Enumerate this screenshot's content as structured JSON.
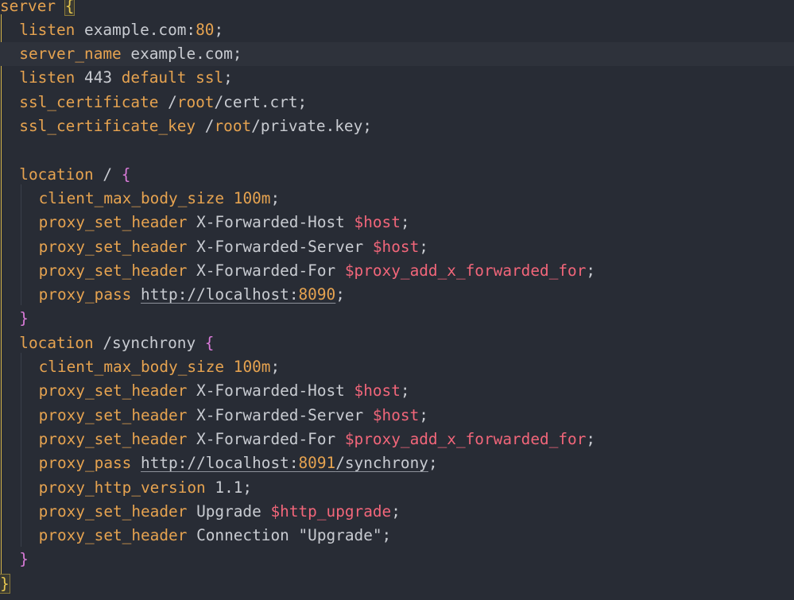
{
  "colors": {
    "background": "#282c35",
    "keyword": "#e6a350",
    "text": "#c9ccd2",
    "variable": "#f2667a",
    "brace": "#d97ad8",
    "bracket_match": "#e6c74f",
    "current_line": "#2e323b"
  },
  "lines": [
    {
      "indent": 0,
      "tokens": [
        {
          "t": "kw",
          "v": "server"
        },
        {
          "t": "txt",
          "v": " "
        },
        {
          "t": "match",
          "v": "{"
        }
      ]
    },
    {
      "indent": 1,
      "tokens": [
        {
          "t": "kw",
          "v": "listen"
        },
        {
          "t": "txt",
          "v": " example.com:"
        },
        {
          "t": "num",
          "v": "80"
        },
        {
          "t": "txt",
          "v": ";"
        }
      ]
    },
    {
      "indent": 1,
      "current": true,
      "tokens": [
        {
          "t": "kw",
          "v": "server_name"
        },
        {
          "t": "txt",
          "v": " example.com;"
        }
      ]
    },
    {
      "indent": 1,
      "tokens": [
        {
          "t": "kw",
          "v": "listen"
        },
        {
          "t": "txt",
          "v": " 443 "
        },
        {
          "t": "kw",
          "v": "default"
        },
        {
          "t": "txt",
          "v": " "
        },
        {
          "t": "kw",
          "v": "ssl"
        },
        {
          "t": "txt",
          "v": ";"
        }
      ]
    },
    {
      "indent": 1,
      "tokens": [
        {
          "t": "kw",
          "v": "ssl_certificate"
        },
        {
          "t": "txt",
          "v": " /"
        },
        {
          "t": "kw",
          "v": "root"
        },
        {
          "t": "txt",
          "v": "/cert.crt;"
        }
      ]
    },
    {
      "indent": 1,
      "tokens": [
        {
          "t": "kw",
          "v": "ssl_certificate_key"
        },
        {
          "t": "txt",
          "v": " /"
        },
        {
          "t": "kw",
          "v": "root"
        },
        {
          "t": "txt",
          "v": "/private.key;"
        }
      ]
    },
    {
      "indent": 0,
      "tokens": []
    },
    {
      "indent": 1,
      "tokens": [
        {
          "t": "kw",
          "v": "location"
        },
        {
          "t": "txt",
          "v": " / "
        },
        {
          "t": "brc",
          "v": "{"
        }
      ]
    },
    {
      "indent": 2,
      "tokens": [
        {
          "t": "kw",
          "v": "client_max_body_size"
        },
        {
          "t": "txt",
          "v": " "
        },
        {
          "t": "num",
          "v": "100m"
        },
        {
          "t": "txt",
          "v": ";"
        }
      ]
    },
    {
      "indent": 2,
      "tokens": [
        {
          "t": "kw",
          "v": "proxy_set_header"
        },
        {
          "t": "txt",
          "v": " X-Forwarded-Host "
        },
        {
          "t": "var",
          "v": "$host"
        },
        {
          "t": "txt",
          "v": ";"
        }
      ]
    },
    {
      "indent": 2,
      "tokens": [
        {
          "t": "kw",
          "v": "proxy_set_header"
        },
        {
          "t": "txt",
          "v": " X-Forwarded-Server "
        },
        {
          "t": "var",
          "v": "$host"
        },
        {
          "t": "txt",
          "v": ";"
        }
      ]
    },
    {
      "indent": 2,
      "tokens": [
        {
          "t": "kw",
          "v": "proxy_set_header"
        },
        {
          "t": "txt",
          "v": " X-Forwarded-For "
        },
        {
          "t": "var",
          "v": "$proxy_add_x_forwarded_for"
        },
        {
          "t": "txt",
          "v": ";"
        }
      ]
    },
    {
      "indent": 2,
      "tokens": [
        {
          "t": "kw",
          "v": "proxy_pass"
        },
        {
          "t": "txt",
          "v": " "
        },
        {
          "t": "url",
          "v": "http://localhost:",
          "port": "8090"
        },
        {
          "t": "txt",
          "v": ";"
        }
      ]
    },
    {
      "indent": 1,
      "tokens": [
        {
          "t": "brc",
          "v": "}"
        }
      ]
    },
    {
      "indent": 1,
      "tokens": [
        {
          "t": "kw",
          "v": "location"
        },
        {
          "t": "txt",
          "v": " /synchrony "
        },
        {
          "t": "brc",
          "v": "{"
        }
      ]
    },
    {
      "indent": 2,
      "tokens": [
        {
          "t": "kw",
          "v": "client_max_body_size"
        },
        {
          "t": "txt",
          "v": " "
        },
        {
          "t": "num",
          "v": "100m"
        },
        {
          "t": "txt",
          "v": ";"
        }
      ]
    },
    {
      "indent": 2,
      "tokens": [
        {
          "t": "kw",
          "v": "proxy_set_header"
        },
        {
          "t": "txt",
          "v": " X-Forwarded-Host "
        },
        {
          "t": "var",
          "v": "$host"
        },
        {
          "t": "txt",
          "v": ";"
        }
      ]
    },
    {
      "indent": 2,
      "tokens": [
        {
          "t": "kw",
          "v": "proxy_set_header"
        },
        {
          "t": "txt",
          "v": " X-Forwarded-Server "
        },
        {
          "t": "var",
          "v": "$host"
        },
        {
          "t": "txt",
          "v": ";"
        }
      ]
    },
    {
      "indent": 2,
      "tokens": [
        {
          "t": "kw",
          "v": "proxy_set_header"
        },
        {
          "t": "txt",
          "v": " X-Forwarded-For "
        },
        {
          "t": "var",
          "v": "$proxy_add_x_forwarded_for"
        },
        {
          "t": "txt",
          "v": ";"
        }
      ]
    },
    {
      "indent": 2,
      "tokens": [
        {
          "t": "kw",
          "v": "proxy_pass"
        },
        {
          "t": "txt",
          "v": " "
        },
        {
          "t": "url",
          "v": "http://localhost:",
          "port": "8091",
          "rest": "/synchrony"
        },
        {
          "t": "txt",
          "v": ";"
        }
      ]
    },
    {
      "indent": 2,
      "tokens": [
        {
          "t": "kw",
          "v": "proxy_http_version"
        },
        {
          "t": "txt",
          "v": " 1.1;"
        }
      ]
    },
    {
      "indent": 2,
      "tokens": [
        {
          "t": "kw",
          "v": "proxy_set_header"
        },
        {
          "t": "txt",
          "v": " Upgrade "
        },
        {
          "t": "var",
          "v": "$http_upgrade"
        },
        {
          "t": "txt",
          "v": ";"
        }
      ]
    },
    {
      "indent": 2,
      "tokens": [
        {
          "t": "kw",
          "v": "proxy_set_header"
        },
        {
          "t": "txt",
          "v": " Connection \"Upgrade\";"
        }
      ]
    },
    {
      "indent": 1,
      "tokens": [
        {
          "t": "brc",
          "v": "}"
        }
      ]
    },
    {
      "indent": 0,
      "tokens": [
        {
          "t": "match",
          "v": "}"
        }
      ]
    }
  ]
}
